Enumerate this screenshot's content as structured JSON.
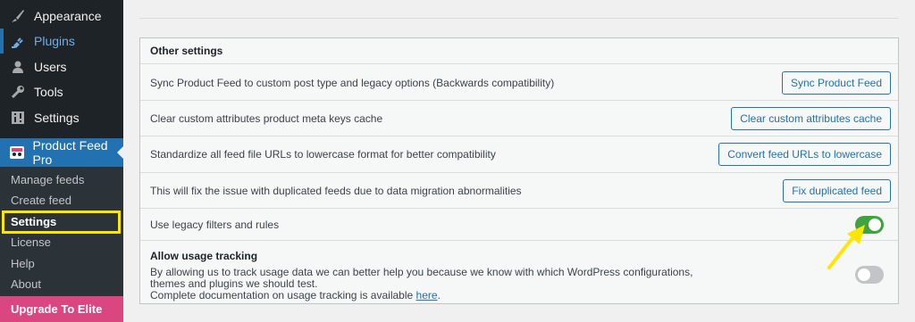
{
  "sidebar": {
    "items": [
      {
        "label": "Appearance",
        "icon": "paintbrush-icon"
      },
      {
        "label": "Plugins",
        "icon": "plugin-icon"
      },
      {
        "label": "Users",
        "icon": "users-icon"
      },
      {
        "label": "Tools",
        "icon": "wrench-icon"
      },
      {
        "label": "Settings",
        "icon": "settings-sliders-icon"
      }
    ],
    "plugin_menu": {
      "label": "Product Feed Pro",
      "icon": "product-feed-icon"
    },
    "submenu": [
      "Manage feeds",
      "Create feed",
      "Settings",
      "License",
      "Help",
      "About"
    ],
    "upgrade_label": "Upgrade To Elite"
  },
  "panel": {
    "header": "Other settings",
    "rows": [
      {
        "text": "Sync Product Feed to custom post type and legacy options (Backwards compatibility)",
        "button": "Sync Product Feed"
      },
      {
        "text": "Clear custom attributes product meta keys cache",
        "button": "Clear custom attributes cache"
      },
      {
        "text": "Standardize all feed file URLs to lowercase format for better compatibility",
        "button": "Convert feed URLs to lowercase"
      },
      {
        "text": "This will fix the issue with duplicated feeds due to data migration abnormalities",
        "button": "Fix duplicated feed"
      }
    ],
    "legacy": {
      "text": "Use legacy filters and rules",
      "enabled": true
    },
    "tracking": {
      "title": "Allow usage tracking",
      "desc": "By allowing us to track usage data we can better help you because we know with which WordPress configurations, themes and plugins we should test.",
      "doc_prefix": "Complete documentation on usage tracking is available",
      "doc_link": "here",
      "doc_suffix": ".",
      "enabled": false
    }
  },
  "colors": {
    "sidebar_bg": "#1d2327",
    "accent": "#2271b1",
    "toggle_on": "#3fa33f",
    "upgrade_bg": "#d94680",
    "highlight": "#ffe600"
  }
}
